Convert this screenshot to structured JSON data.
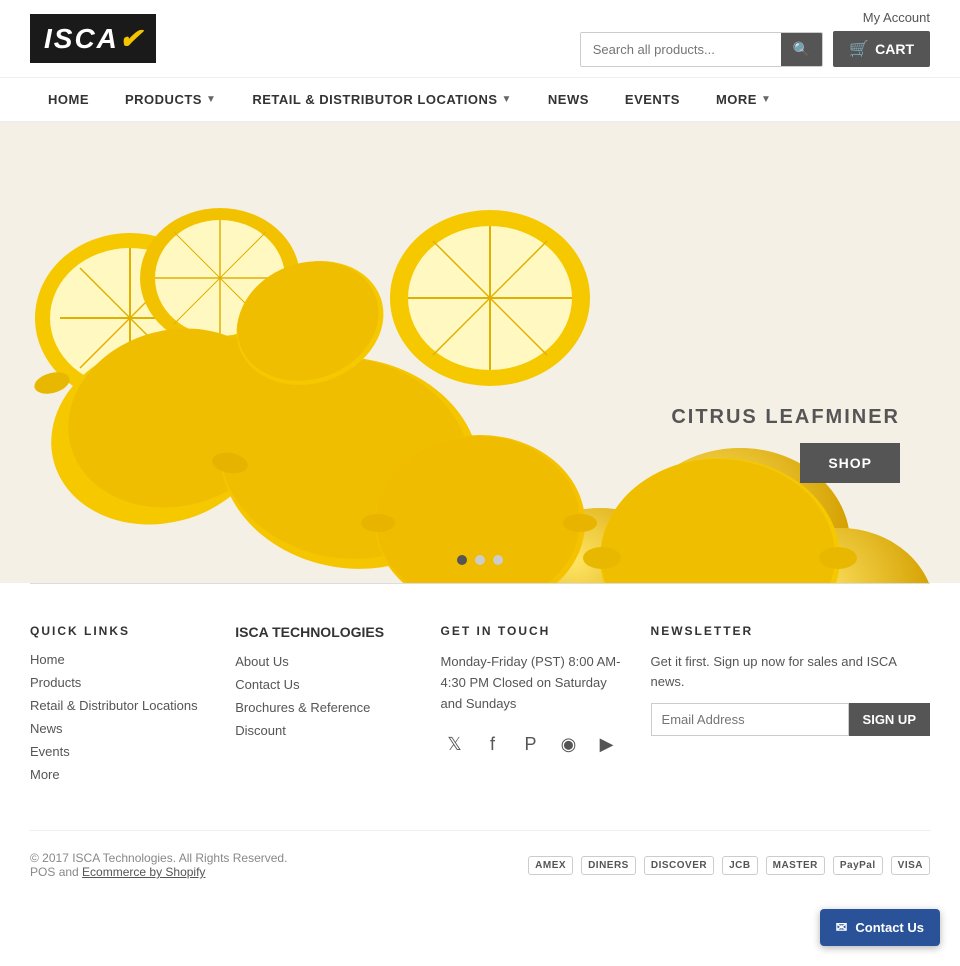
{
  "header": {
    "my_account_label": "My Account",
    "search_placeholder": "Search all products...",
    "cart_label": "CART",
    "logo_main": "ISCA",
    "logo_accent": "✔"
  },
  "nav": {
    "items": [
      {
        "id": "home",
        "label": "HOME",
        "has_dropdown": false
      },
      {
        "id": "products",
        "label": "PRODUCTS",
        "has_dropdown": true
      },
      {
        "id": "retail-distributor",
        "label": "RETAIL & DISTRIBUTOR LOCATIONS",
        "has_dropdown": true
      },
      {
        "id": "news",
        "label": "NEWS",
        "has_dropdown": false
      },
      {
        "id": "events",
        "label": "EVENTS",
        "has_dropdown": false
      },
      {
        "id": "more",
        "label": "MORE",
        "has_dropdown": true
      }
    ]
  },
  "hero": {
    "badge_text": "CITRUS LEAFMINER",
    "shop_button": "SHOP",
    "dots": 3,
    "active_dot": 0
  },
  "footer": {
    "quick_links_title": "QUICK LINKS",
    "quick_links": [
      {
        "label": "Home"
      },
      {
        "label": "Products"
      },
      {
        "label": "Retail & Distributor Locations"
      },
      {
        "label": "News"
      },
      {
        "label": "Events"
      },
      {
        "label": "More"
      }
    ],
    "isca_tech_title": "ISCA TECHNOLOGIES",
    "isca_links": [
      {
        "label": "About Us"
      },
      {
        "label": "Contact Us"
      },
      {
        "label": "Brochures & Reference"
      },
      {
        "label": "Discount"
      }
    ],
    "get_in_touch_title": "GET IN TOUCH",
    "contact_hours": "Monday-Friday (PST) 8:00 AM- 4:30 PM Closed on Saturday and Sundays",
    "social_icons": [
      {
        "name": "twitter",
        "symbol": "𝕏"
      },
      {
        "name": "facebook",
        "symbol": "f"
      },
      {
        "name": "pinterest",
        "symbol": "P"
      },
      {
        "name": "instagram",
        "symbol": "◉"
      },
      {
        "name": "youtube",
        "symbol": "▶"
      }
    ],
    "newsletter_title": "NEWSLETTER",
    "newsletter_desc": "Get it first. Sign up now for sales and ISCA news.",
    "newsletter_placeholder": "Email Address",
    "signup_label": "SIGN UP",
    "copyright": "© 2017 ISCA Technologies. All Rights Reserved.",
    "pos_text": "POS",
    "ecommerce_text": "and",
    "ecommerce_link": "Ecommerce by Shopify",
    "payment_methods": [
      "AMERICAN EXPRESS",
      "DINERS",
      "DISCOVER",
      "JCB",
      "MASTER",
      "PAYPAL",
      "VISA"
    ]
  },
  "floating_contact": {
    "label": "Contact Us",
    "icon": "✉"
  }
}
